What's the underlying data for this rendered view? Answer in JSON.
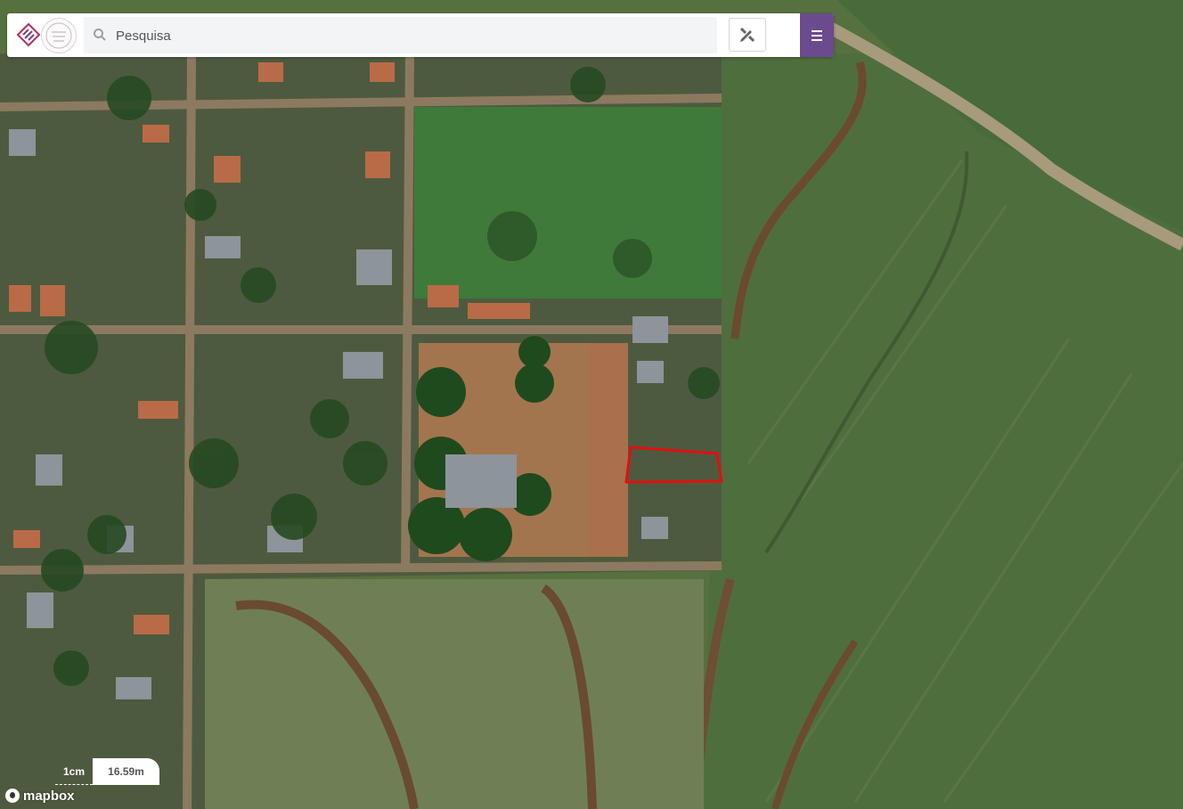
{
  "search": {
    "placeholder": "Pesquisa"
  },
  "icons": {
    "brand_logo": "brand-logo-icon",
    "seal": "municipal-seal-icon",
    "search": "search-icon",
    "tool": "drawing-tools-icon",
    "menu": "hamburger-menu-icon"
  },
  "colors": {
    "menu_accent": "#6c4a8e",
    "highlight_outline": "#e01010"
  },
  "scale": {
    "left_label": "1cm",
    "right_label": "16.59m"
  },
  "attribution": {
    "label": "mapbox"
  }
}
